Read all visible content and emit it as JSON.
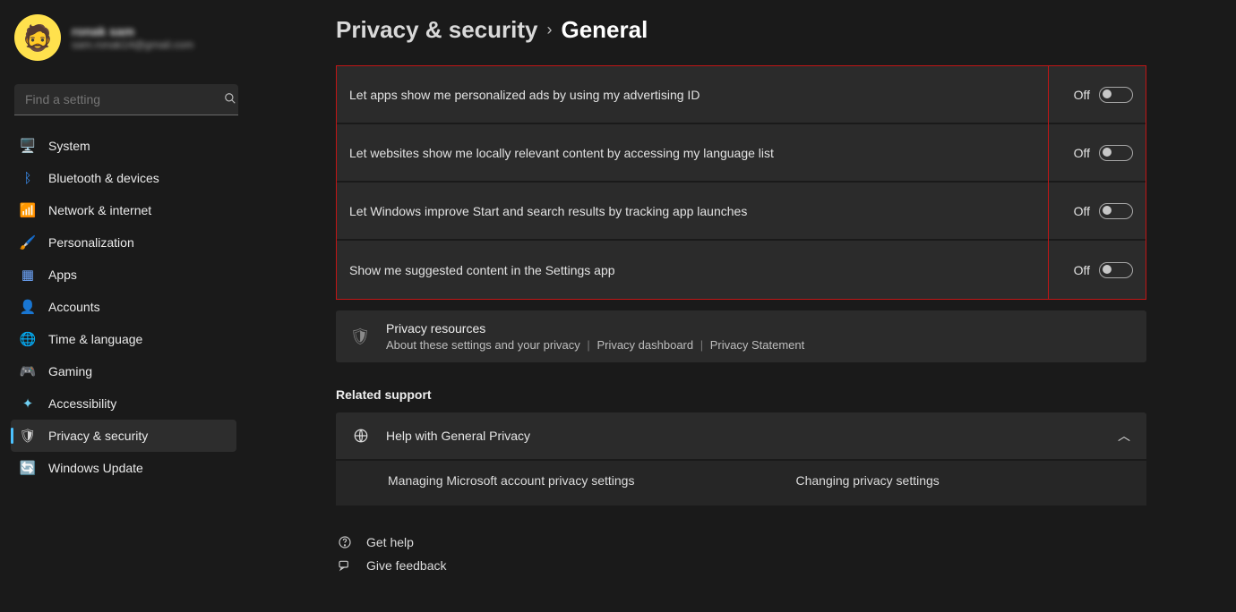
{
  "profile": {
    "name": "ronak sam",
    "email": "sam.ronak14@gmail.com"
  },
  "search": {
    "placeholder": "Find a setting"
  },
  "nav": [
    {
      "label": "System",
      "icon": "🖥️",
      "cls": "ico-system",
      "name": "sidebar-item-system"
    },
    {
      "label": "Bluetooth & devices",
      "icon": "ᛒ",
      "cls": "ico-bt",
      "name": "sidebar-item-bluetooth"
    },
    {
      "label": "Network & internet",
      "icon": "📶",
      "cls": "ico-net",
      "name": "sidebar-item-network"
    },
    {
      "label": "Personalization",
      "icon": "🖌️",
      "cls": "ico-pers",
      "name": "sidebar-item-personalization"
    },
    {
      "label": "Apps",
      "icon": "▦",
      "cls": "ico-apps",
      "name": "sidebar-item-apps"
    },
    {
      "label": "Accounts",
      "icon": "👤",
      "cls": "ico-acc",
      "name": "sidebar-item-accounts"
    },
    {
      "label": "Time & language",
      "icon": "🌐",
      "cls": "ico-time",
      "name": "sidebar-item-time-language"
    },
    {
      "label": "Gaming",
      "icon": "🎮",
      "cls": "ico-game",
      "name": "sidebar-item-gaming"
    },
    {
      "label": "Accessibility",
      "icon": "✦",
      "cls": "ico-a11y",
      "name": "sidebar-item-accessibility"
    },
    {
      "label": "Privacy & security",
      "icon": "🛡",
      "cls": "ico-priv",
      "name": "sidebar-item-privacy-security",
      "active": true
    },
    {
      "label": "Windows Update",
      "icon": "🔄",
      "cls": "ico-upd",
      "name": "sidebar-item-windows-update"
    }
  ],
  "breadcrumb": {
    "parent": "Privacy & security",
    "current": "General"
  },
  "toggles": [
    {
      "desc": "Let apps show me personalized ads by using my advertising ID",
      "state": "Off"
    },
    {
      "desc": "Let websites show me locally relevant content by accessing my language list",
      "state": "Off"
    },
    {
      "desc": "Let Windows improve Start and search results by tracking app launches",
      "state": "Off"
    },
    {
      "desc": "Show me suggested content in the Settings app",
      "state": "Off"
    }
  ],
  "resources": {
    "title": "Privacy resources",
    "link1": "About these settings and your privacy",
    "link2": "Privacy dashboard",
    "link3": "Privacy Statement"
  },
  "related": {
    "heading": "Related support",
    "help_title": "Help with General Privacy",
    "child1": "Managing Microsoft account privacy settings",
    "child2": "Changing privacy settings"
  },
  "footer": {
    "get_help": "Get help",
    "give_feedback": "Give feedback"
  }
}
